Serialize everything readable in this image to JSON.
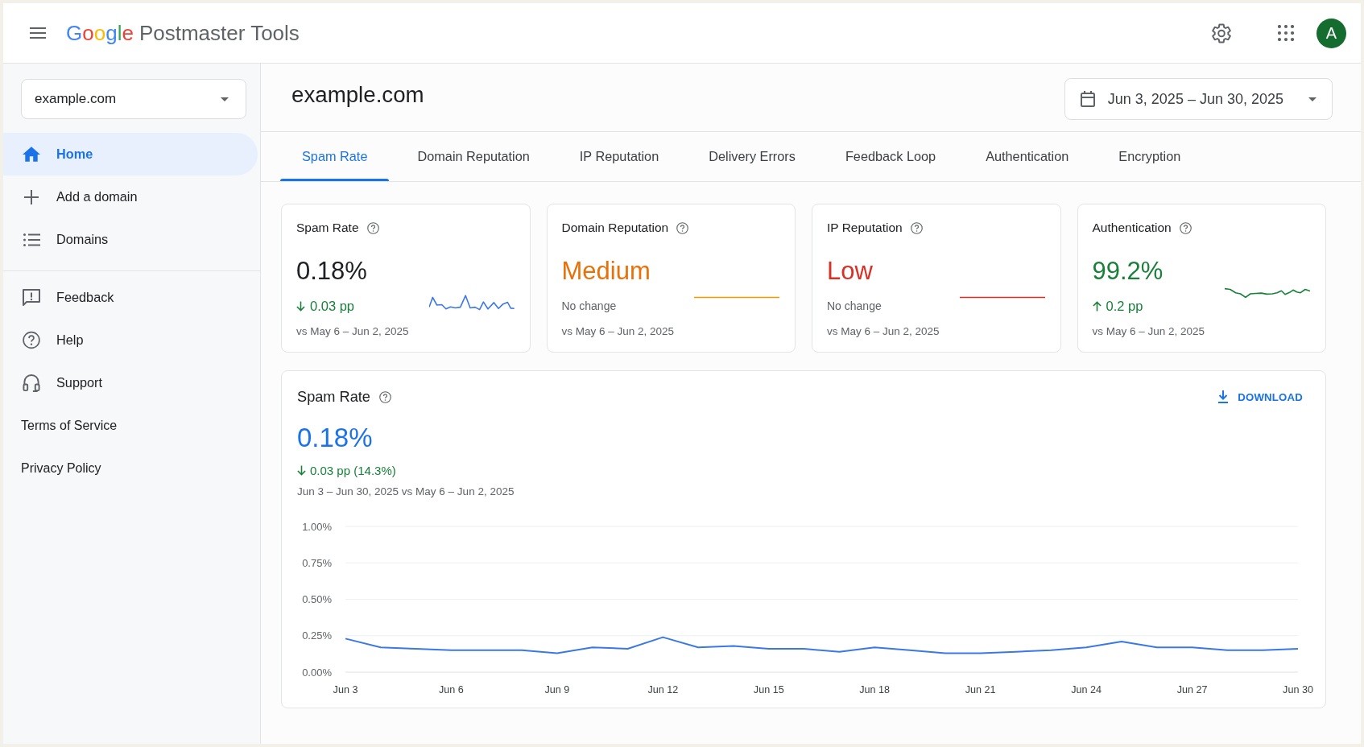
{
  "app_bar": {
    "logo": "Google",
    "title": "Postmaster Tools",
    "avatar": "A"
  },
  "sidebar": {
    "domain_select": {
      "value": "example.com"
    },
    "nav": [
      {
        "label": "Home",
        "selected": true
      },
      {
        "label": "Add a domain",
        "selected": false
      },
      {
        "label": "Domains",
        "selected": false
      }
    ],
    "support_nav": [
      {
        "label": "Feedback",
        "selected": false
      },
      {
        "label": "Help",
        "selected": false
      },
      {
        "label": "Support",
        "selected": false
      }
    ],
    "links": [
      "Terms of Service",
      "Privacy Policy"
    ]
  },
  "header": {
    "title": "example.com",
    "date_range": {
      "value": "Jun 3, 2025 – Jun 30, 2025"
    }
  },
  "tabs": [
    {
      "label": "Spam Rate",
      "selected": true
    },
    {
      "label": "Domain Reputation",
      "selected": false
    },
    {
      "label": "IP Reputation",
      "selected": false
    },
    {
      "label": "Delivery Errors",
      "selected": false
    },
    {
      "label": "Feedback Loop",
      "selected": false
    },
    {
      "label": "Authentication",
      "selected": false
    },
    {
      "label": "Encryption",
      "selected": false
    }
  ],
  "cards": [
    {
      "title": "Spam Rate",
      "value": {
        "text": "0.18%",
        "color": "#202124"
      },
      "delta": {
        "kind": "down",
        "text": "0.03 pp",
        "color": "#188038"
      },
      "comparison": "vs May 6 – Jun 2, 2025",
      "sparkline": {
        "kind": "spiky",
        "color": "#3b78e7"
      }
    },
    {
      "title": "Domain Reputation",
      "value": {
        "text": "Medium",
        "color": "#e8710a"
      },
      "delta": {
        "kind": "none",
        "text": "No change",
        "color": "#5f6368"
      },
      "comparison": "vs May 6 – Jun 2, 2025",
      "sparkline": {
        "kind": "flat",
        "color": "#f29900"
      }
    },
    {
      "title": "IP Reputation",
      "value": {
        "text": "Low",
        "color": "#d93025"
      },
      "delta": {
        "kind": "none",
        "text": "No change",
        "color": "#5f6368"
      },
      "comparison": "vs May 6 – Jun 2, 2025",
      "sparkline": {
        "kind": "flat",
        "color": "#d93025"
      }
    },
    {
      "title": "Authentication",
      "value": {
        "text": "99.2%",
        "color": "#188038"
      },
      "delta": {
        "kind": "up",
        "text": "0.2 pp",
        "color": "#188038"
      },
      "comparison": "vs May 6 – Jun 2, 2025",
      "sparkline": {
        "kind": "wavy",
        "color": "#188038"
      }
    }
  ],
  "chart_panel": {
    "title": "Spam Rate",
    "download": "DOWNLOAD",
    "value": "0.18%",
    "delta": {
      "kind": "down",
      "text": "0.03 pp (14.3%)",
      "color": "#188038"
    },
    "comparison": "Jun 3 – Jun 30, 2025 vs May 6 – Jun 2, 2025",
    "chart_data": {
      "type": "line",
      "categories": [
        "Jun 3",
        null,
        null,
        "Jun 6",
        null,
        null,
        "Jun 9",
        null,
        null,
        "Jun 12",
        null,
        null,
        "Jun 15",
        null,
        null,
        "Jun 18",
        null,
        null,
        "Jun 21",
        null,
        null,
        "Jun 24",
        null,
        null,
        "Jun 27",
        null,
        null,
        "Jun 30"
      ],
      "series": [
        {
          "color": "#3b78e7",
          "values": [
            0.23,
            0.17,
            0.16,
            0.15,
            0.15,
            0.15,
            0.13,
            0.17,
            0.16,
            0.24,
            0.17,
            0.18,
            0.16,
            0.16,
            0.14,
            0.17,
            0.15,
            0.13,
            0.13,
            0.14,
            0.15,
            0.17,
            0.21,
            0.17,
            0.17,
            0.15,
            0.15,
            0.16
          ]
        }
      ],
      "ylim": [
        0,
        1
      ],
      "yticks": [
        {
          "value": 1,
          "label": "1.00%"
        },
        {
          "value": 0.75,
          "label": "0.75%"
        },
        {
          "value": 0.5,
          "label": "0.50%"
        },
        {
          "value": 0.25,
          "label": "0.25%"
        },
        {
          "value": 0,
          "label": "0.00%"
        }
      ],
      "grid": true
    }
  }
}
